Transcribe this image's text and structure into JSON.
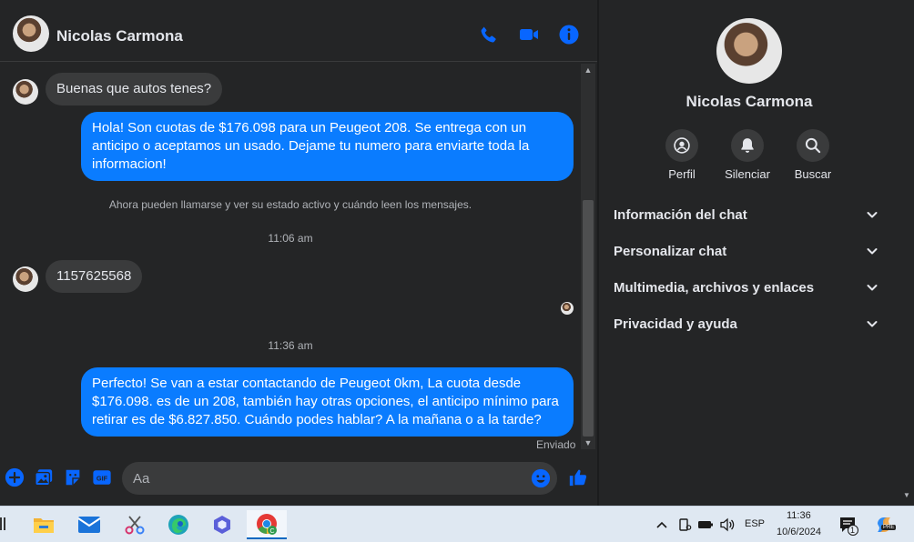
{
  "header": {
    "contact_name": "Nicolas Carmona"
  },
  "messages": {
    "m1": "Buenas que autos tenes?",
    "m2": "Hola! Son cuotas de $176.098 para un Peugeot 208. Se entrega con un anticipo o aceptamos un usado. Dejame tu numero para enviarte toda la informacion!",
    "sys": "Ahora pueden llamarse y ver su estado activo y cuándo leen los mensajes.",
    "time1": "11:06 am",
    "m3": "1157625568",
    "time2": "11:36 am",
    "m4": "Perfecto!  Se van a estar contactando de Peugeot 0km, La cuota desde $176.098. es de un 208, también hay otras opciones, el anticipo mínimo para retirar es de $6.827.850. Cuándo podes hablar? A la mañana o a la tarde?",
    "status": "Enviado"
  },
  "composer": {
    "placeholder": "Aa"
  },
  "side": {
    "name": "Nicolas Carmona",
    "actions": [
      "Perfil",
      "Silenciar",
      "Buscar"
    ],
    "sections": [
      "Información del chat",
      "Personalizar chat",
      "Multimedia, archivos y enlaces",
      "Privacidad y ayuda"
    ]
  },
  "taskbar": {
    "lang": "ESP",
    "time": "11:36",
    "date": "10/6/2024",
    "notif_count": "1",
    "copilot_badge": "PRE"
  },
  "colors": {
    "accent": "#0a7cff",
    "icon_blue": "#0866ff",
    "bg": "#242526",
    "bubble_in": "#3a3b3c"
  }
}
